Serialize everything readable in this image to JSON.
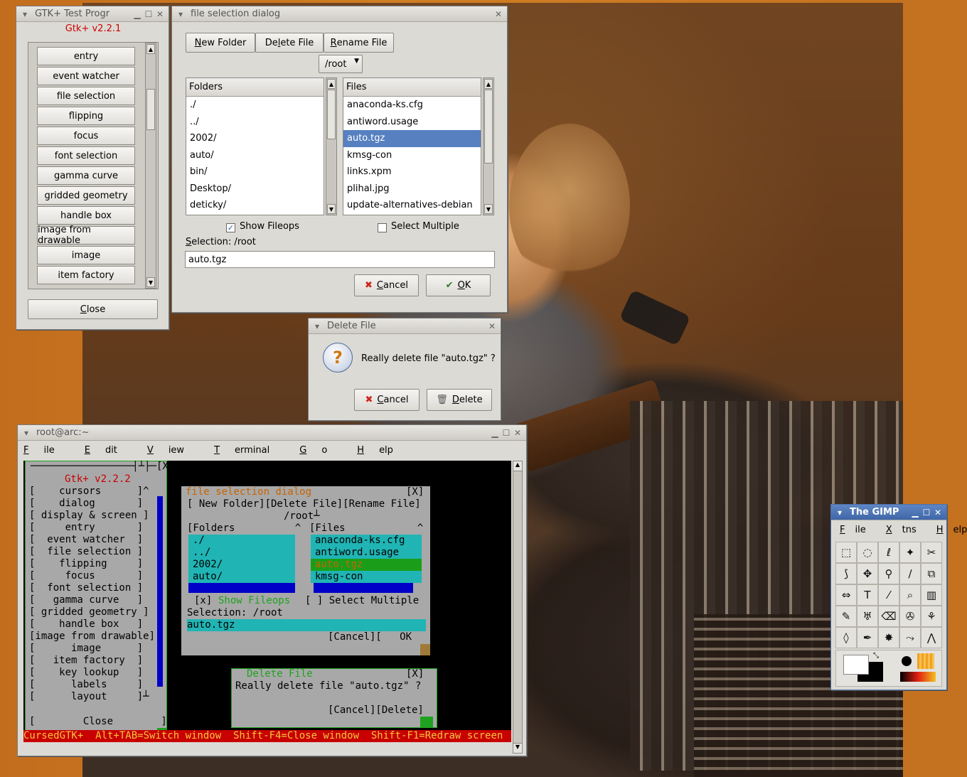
{
  "gtk_test": {
    "title": "GTK+ Test Progr",
    "version": "Gtk+ v2.2.1",
    "items": [
      "entry",
      "event watcher",
      "file selection",
      "flipping",
      "focus",
      "font selection",
      "gamma curve",
      "gridded geometry",
      "handle box",
      "image from drawable",
      "image",
      "item factory"
    ],
    "close_prefix": "",
    "close_u": "C",
    "close_rest": "lose"
  },
  "file_dialog": {
    "title": "file selection dialog",
    "new_folder_u": "N",
    "new_folder_rest": "ew Folder",
    "delete_pre": "De",
    "delete_u": "l",
    "delete_rest": "ete File",
    "rename_u": "R",
    "rename_rest": "ename File",
    "path": "/root",
    "folders_header_pre": "Fol",
    "folders_header_u": "d",
    "folders_header_rest": "ers",
    "files_header_u": "F",
    "files_header_rest": "iles",
    "folders": [
      "./",
      "../",
      "2002/",
      "auto/",
      "bin/",
      "Desktop/",
      "deticky/"
    ],
    "files": [
      "anaconda-ks.cfg",
      "antiword.usage",
      "auto.tgz",
      "kmsg-con",
      "links.xpm",
      "plihal.jpg",
      "update-alternatives-debian"
    ],
    "selected_file": "auto.tgz",
    "show_fileops": "Show Fileops",
    "select_multiple": "Select Multiple",
    "selection_label_u": "S",
    "selection_label_rest": "election: /root",
    "selection_value": "auto.tgz",
    "cancel_u": "C",
    "cancel_rest": "ancel",
    "ok_u": "O",
    "ok_rest": "K"
  },
  "delete_dialog": {
    "title": "Delete File",
    "message": "Really delete file \"auto.tgz\" ?",
    "cancel_u": "C",
    "cancel_rest": "ancel",
    "delete_u": "D",
    "delete_rest": "elete"
  },
  "terminal": {
    "title": "root@arc:~",
    "menus": [
      {
        "u": "F",
        "rest": "ile"
      },
      {
        "u": "E",
        "rest": "dit"
      },
      {
        "u": "V",
        "rest": "iew"
      },
      {
        "u": "T",
        "rest": "erminal"
      },
      {
        "u": "G",
        "rest": "o"
      },
      {
        "u": "H",
        "rest": "elp"
      }
    ],
    "lines": {
      "l0": "─────────────────┤┴├─[X]┐",
      "version": "Gtk+ v2.2.2",
      "items": [
        "[    cursors      ]^",
        "[    dialog       ]",
        "[ display & screen ]",
        "[     entry       ]",
        "[  event watcher  ]",
        "[  file selection ]",
        "[    flipping     ]",
        "[     focus       ]",
        "[  font selection ]",
        "[   gamma curve   ]",
        "[ gridded geometry ]",
        "[    handle box   ]",
        "[image from drawable]",
        "[      image      ]",
        "[   item factory  ]",
        "[    key lookup   ]",
        "[      labels     ]",
        "[      layout     ]┴"
      ],
      "close": "[        Close        ]",
      "fs_title": "file selection dialog",
      "fs_close": "[X]",
      "fs_buttons": "[ New Folder][Delete File][Rename File]",
      "fs_path": "/root┴",
      "fs_folders_hdr": "[Folders          ^",
      "fs_files_hdr": "[Files            ^",
      "fs_folders": [
        "./",
        "../",
        "2002/",
        "auto/"
      ],
      "fs_files": [
        "anaconda-ks.cfg",
        "antiword.usage",
        "auto.tgz",
        "kmsg-con"
      ],
      "fs_show_fileops_mark": "[x]",
      "fs_show_fileops": "Show Fileops",
      "fs_select_multiple": "[ ] Select Multiple",
      "fs_selection": "Selection: /root",
      "fs_entry": "auto.tgz",
      "fs_cancel_ok": "[Cancel][   OK   ]",
      "del_title": "Delete File",
      "del_close": "[X]",
      "del_message": "Really delete file \"auto.tgz\" ?",
      "del_buttons": "[Cancel][Delete]",
      "status": "CursedGTK+  Alt+TAB=Switch window  Shift-F4=Close window  Shift-F1=Redraw screen"
    }
  },
  "gimp": {
    "title": "The GIMP",
    "menus": [
      {
        "u": "F",
        "rest": "ile"
      },
      {
        "u": "X",
        "rest": "tns"
      },
      {
        "u": "H",
        "rest": "elp"
      }
    ],
    "tools": [
      "rect-select-icon",
      "ellipse-select-icon",
      "lasso-icon",
      "magic-wand-icon",
      "scissors-icon",
      "bezier-icon",
      "move-icon",
      "magnify-icon",
      "crop-icon",
      "transform-icon",
      "flip-icon",
      "text-icon",
      "color-picker-icon",
      "bucket-fill-icon",
      "gradient-icon",
      "pencil-icon",
      "paintbrush-icon",
      "eraser-icon",
      "airbrush-icon",
      "clone-icon",
      "convolve-icon",
      "ink-icon",
      "dodge-burn-icon",
      "smudge-icon",
      "measure-icon"
    ],
    "tool_glyphs": [
      "⬚",
      "◌",
      "ℓ",
      "✦",
      "✂",
      "⟆",
      "✥",
      "⚲",
      "∕",
      "⧉",
      "⇔",
      "T",
      "⁄",
      "⌕",
      "▥",
      "✎",
      "♅",
      "⌫",
      "✇",
      "⚘",
      "◊",
      "✒",
      "✸",
      "⤳",
      "⋀"
    ]
  }
}
